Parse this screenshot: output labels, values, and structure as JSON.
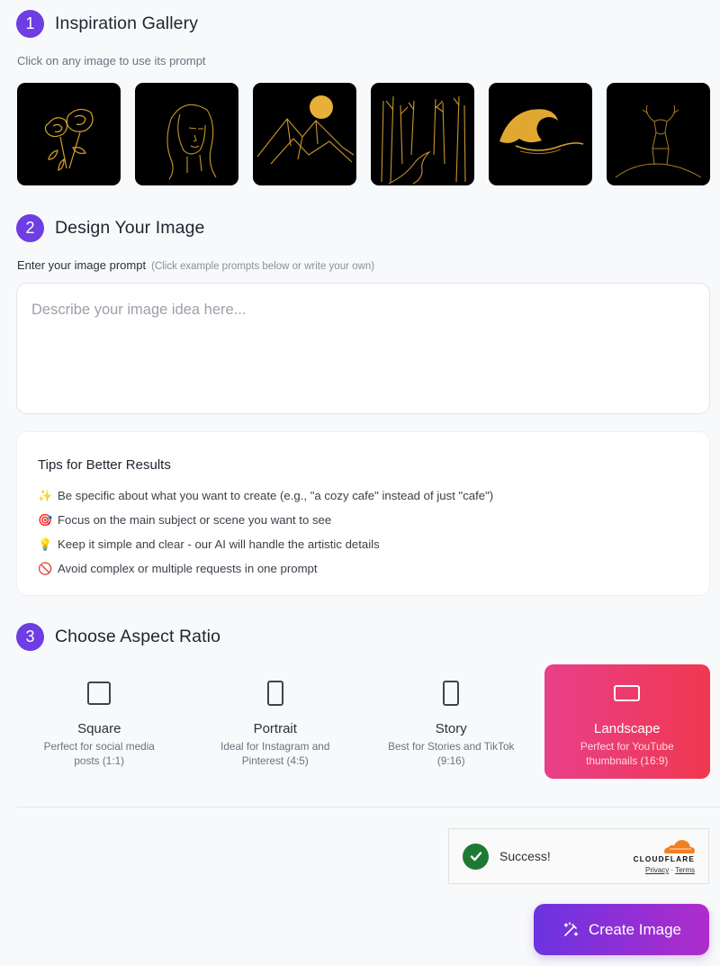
{
  "gallery_section": {
    "step": "1",
    "title": "Inspiration Gallery",
    "subtitle": "Click on any image to use its prompt",
    "images": [
      {
        "subject": "gold line-art roses"
      },
      {
        "subject": "gold line-art woman portrait"
      },
      {
        "subject": "gold mountains with golden moon"
      },
      {
        "subject": "gold line-art forest path"
      },
      {
        "subject": "golden great wave"
      },
      {
        "subject": "gold line-art deer on hill"
      }
    ]
  },
  "design_section": {
    "step": "2",
    "title": "Design Your Image",
    "prompt_label": "Enter your image prompt",
    "prompt_hint": "(Click example prompts below or write your own)",
    "prompt_value": "",
    "prompt_placeholder": "Describe your image idea here...",
    "tips": {
      "title": "Tips for Better Results",
      "items": [
        {
          "icon": "sparkles-icon",
          "glyph": "✨",
          "text": "Be specific about what you want to create (e.g., \"a cozy cafe\" instead of just \"cafe\")"
        },
        {
          "icon": "target-icon",
          "glyph": "🎯",
          "text": "Focus on the main subject or scene you want to see"
        },
        {
          "icon": "lightbulb-icon",
          "glyph": "💡",
          "text": "Keep it simple and clear - our AI will handle the artistic details"
        },
        {
          "icon": "prohibited-icon",
          "glyph": "🚫",
          "text": "Avoid complex or multiple requests in one prompt"
        }
      ]
    }
  },
  "aspect_section": {
    "step": "3",
    "title": "Choose Aspect Ratio",
    "selected": "landscape",
    "options": [
      {
        "id": "square",
        "name": "Square",
        "desc": "Perfect for social media posts (1:1)"
      },
      {
        "id": "portrait",
        "name": "Portrait",
        "desc": "Ideal for Instagram and Pinterest (4:5)"
      },
      {
        "id": "story",
        "name": "Story",
        "desc": "Best for Stories and TikTok (9:16)"
      },
      {
        "id": "landscape",
        "name": "Landscape",
        "desc": "Perfect for YouTube thumbnails (16:9)"
      }
    ]
  },
  "captcha": {
    "status": "Success!",
    "brand": "CLOUDFLARE",
    "privacy": "Privacy",
    "separator": "·",
    "terms": "Terms"
  },
  "actions": {
    "create_label": "Create Image"
  },
  "colors": {
    "accent_purple": "#6d3ee3",
    "selected_gradient_start": "#e83f8a",
    "selected_gradient_end": "#f0384f",
    "success_green": "#1d7a33",
    "cloudflare_orange": "#f38020",
    "gold": "#d4a02a"
  }
}
